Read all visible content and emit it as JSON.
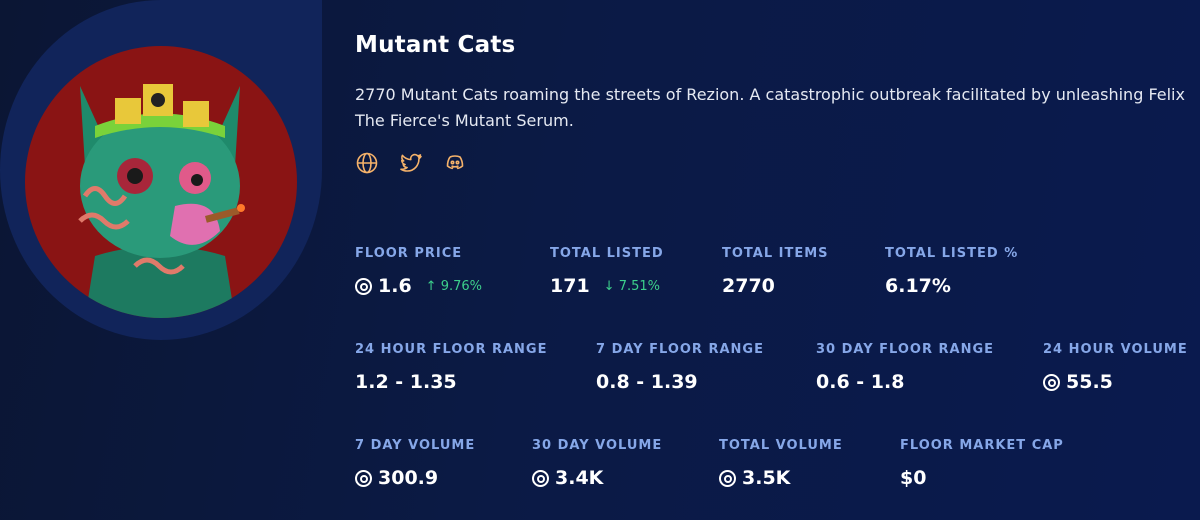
{
  "collection": {
    "name": "Mutant Cats",
    "description": "2770 Mutant Cats roaming the streets of Rezion. A catastrophic outbreak facilitated by unleashing Felix The Fierce's Mutant Serum.",
    "socials": [
      "globe-icon",
      "twitter-icon",
      "discord-icon"
    ],
    "accent_color": "#f5b26a",
    "avatar_bg": "#8a1414"
  },
  "stats": {
    "floor_price": {
      "label": "FLOOR PRICE",
      "value": "1.6",
      "change": "9.76%",
      "direction": "up"
    },
    "total_listed": {
      "label": "TOTAL LISTED",
      "value": "171",
      "change": "7.51%",
      "direction": "down"
    },
    "total_items": {
      "label": "TOTAL ITEMS",
      "value": "2770"
    },
    "total_listed_pct": {
      "label": "TOTAL LISTED %",
      "value": "6.17%"
    },
    "floor_range_24h": {
      "label": "24 HOUR FLOOR RANGE",
      "value": "1.2 - 1.35"
    },
    "floor_range_7d": {
      "label": "7 DAY FLOOR RANGE",
      "value": "0.8 - 1.39"
    },
    "floor_range_30d": {
      "label": "30 DAY FLOOR RANGE",
      "value": "0.6 - 1.8"
    },
    "volume_24h": {
      "label": "24 HOUR VOLUME",
      "value": "55.5"
    },
    "volume_7d": {
      "label": "7 DAY VOLUME",
      "value": "300.9"
    },
    "volume_30d": {
      "label": "30 DAY VOLUME",
      "value": "3.4K"
    },
    "total_volume": {
      "label": "TOTAL VOLUME",
      "value": "3.5K"
    },
    "floor_market_cap": {
      "label": "FLOOR MARKET CAP",
      "value": "$0"
    }
  }
}
